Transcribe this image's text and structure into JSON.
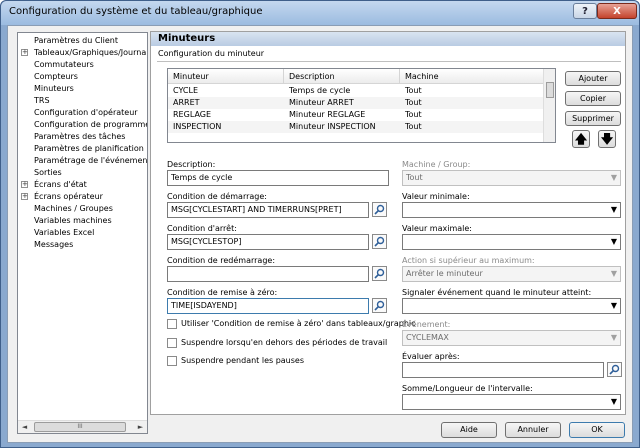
{
  "window": {
    "title": "Configuration du système et du tableau/graphique",
    "help_label": "?",
    "close_label": "X"
  },
  "tree": {
    "items": [
      {
        "label": "Paramètres du Client",
        "expander": ""
      },
      {
        "label": "Tableaux/Graphiques/Journa",
        "expander": "+"
      },
      {
        "label": "Commutateurs",
        "expander": ""
      },
      {
        "label": "Compteurs",
        "expander": ""
      },
      {
        "label": "Minuteurs",
        "expander": ""
      },
      {
        "label": "TRS",
        "expander": ""
      },
      {
        "label": "Configuration d'opérateur",
        "expander": ""
      },
      {
        "label": "Configuration de programme",
        "expander": ""
      },
      {
        "label": "Paramètres des tâches",
        "expander": ""
      },
      {
        "label": "Paramètres de planification",
        "expander": ""
      },
      {
        "label": "Paramétrage de l'événement",
        "expander": ""
      },
      {
        "label": "Sorties",
        "expander": ""
      },
      {
        "label": "Écrans d'état",
        "expander": "+"
      },
      {
        "label": "Écrans opérateur",
        "expander": "+"
      },
      {
        "label": "Machines / Groupes",
        "expander": ""
      },
      {
        "label": "Variables machines",
        "expander": ""
      },
      {
        "label": "Variables Excel",
        "expander": ""
      },
      {
        "label": "Messages",
        "expander": ""
      }
    ],
    "scroll_left": "◄",
    "scroll_right": "►",
    "scroll_thumb": "III"
  },
  "panel": {
    "title": "Minuteurs",
    "subtitle": "Configuration du minuteur",
    "table": {
      "headers": [
        "Minuteur",
        "Description",
        "Machine"
      ],
      "rows": [
        [
          "CYCLE",
          "Temps de cycle",
          "Tout"
        ],
        [
          "ARRET",
          "Minuteur ARRET",
          "Tout"
        ],
        [
          "REGLAGE",
          "Minuteur REGLAGE",
          "Tout"
        ],
        [
          "INSPECTION",
          "Minuteur INSPECTION",
          "Tout"
        ]
      ]
    },
    "buttons": {
      "add": "Ajouter",
      "copy": "Copier",
      "delete": "Supprimer",
      "up": "🡅",
      "down": "🡇"
    },
    "form": {
      "description_label": "Description:",
      "description_value": "Temps de cycle",
      "start_label": "Condition de démarrage:",
      "start_value": "MSG[CYCLESTART] AND TIMERRUNS[PRET]",
      "stop_label": "Condition d'arrêt:",
      "stop_value": "MSG[CYCLESTOP]",
      "restart_label": "Condition de redémarrage:",
      "restart_value": "",
      "reset_label": "Condition de remise à zéro:",
      "reset_value": "TIME[ISDAYEND]",
      "chk_reset_label": "Utiliser 'Condition de remise à zéro' dans tableaux/graphic",
      "chk_outside_label": "Suspendre lorsqu'en dehors des périodes de travail",
      "chk_pauses_label": "Suspendre pendant les pauses",
      "machine_label": "Machine / Group:",
      "machine_value": "Tout",
      "min_label": "Valeur minimale:",
      "min_value": "",
      "max_label": "Valeur maximale:",
      "max_value": "",
      "action_label": "Action si supérieur au maximum:",
      "action_value": "Arrêter le minuteur",
      "signal_label": "Signaler événement quand le minuteur atteint:",
      "signal_value": "",
      "event_label": "Événement:",
      "event_value": "CYCLEMAX",
      "eval_label": "Évaluer après:",
      "eval_value": "",
      "sum_label": "Somme/Longueur de l'intervalle:",
      "sum_value": ""
    }
  },
  "footer": {
    "help": "Aide",
    "cancel": "Annuler",
    "ok": "OK"
  },
  "icons": {
    "caret": "▼"
  }
}
